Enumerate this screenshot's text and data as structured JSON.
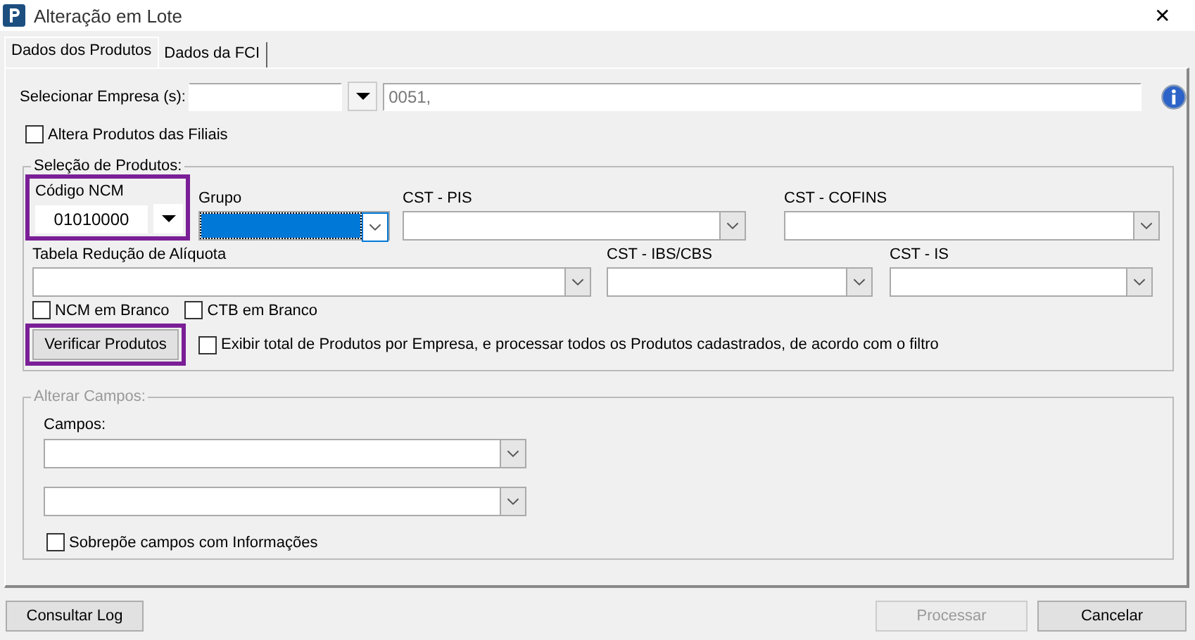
{
  "window": {
    "title": "Alteração em Lote",
    "close": "✕"
  },
  "tabs": [
    {
      "label": "Dados dos Produtos",
      "selected": true
    },
    {
      "label": "Dados da FCI",
      "selected": false
    }
  ],
  "empresa": {
    "label": "Selecionar Empresa (s):",
    "value": "0051,"
  },
  "altera_filiais": {
    "label": "Altera Produtos das Filiais",
    "checked": false
  },
  "selecao": {
    "title": "Seleção de Produtos:",
    "ncm": {
      "label": "Código NCM",
      "value": "01010000",
      "highlighted": true
    },
    "row1": [
      {
        "label": "Grupo",
        "focused": true
      },
      {
        "label": "CST - PIS",
        "focused": false
      },
      {
        "label": "CST - COFINS",
        "focused": false
      }
    ],
    "row2": [
      {
        "label": "Tabela Redução de Alíquota",
        "focused": false
      },
      {
        "label": "CST - IBS/CBS",
        "focused": false
      },
      {
        "label": "CST - IS",
        "focused": false
      }
    ],
    "checks": [
      {
        "label": "NCM em Branco",
        "checked": false
      },
      {
        "label": "CTB em Branco",
        "checked": false
      }
    ],
    "verify_button": {
      "label": "Verificar Produtos",
      "highlighted": true
    },
    "exibir": {
      "label": "Exibir total de Produtos por Empresa, e processar todos os Produtos cadastrados, de acordo com o filtro",
      "checked": false
    }
  },
  "alterar": {
    "title": "Alterar Campos:",
    "disabled": true,
    "campos_label": "Campos:",
    "combos": [
      {
        "focused": false
      },
      {
        "focused": false
      }
    ],
    "sobrepoe": {
      "label": "Sobrepõe campos com Informações",
      "checked": false
    }
  },
  "footer": [
    {
      "label": "Consultar Log",
      "disabled": false
    },
    {
      "label": "Processar",
      "disabled": true
    },
    {
      "label": "Cancelar",
      "disabled": false
    }
  ]
}
